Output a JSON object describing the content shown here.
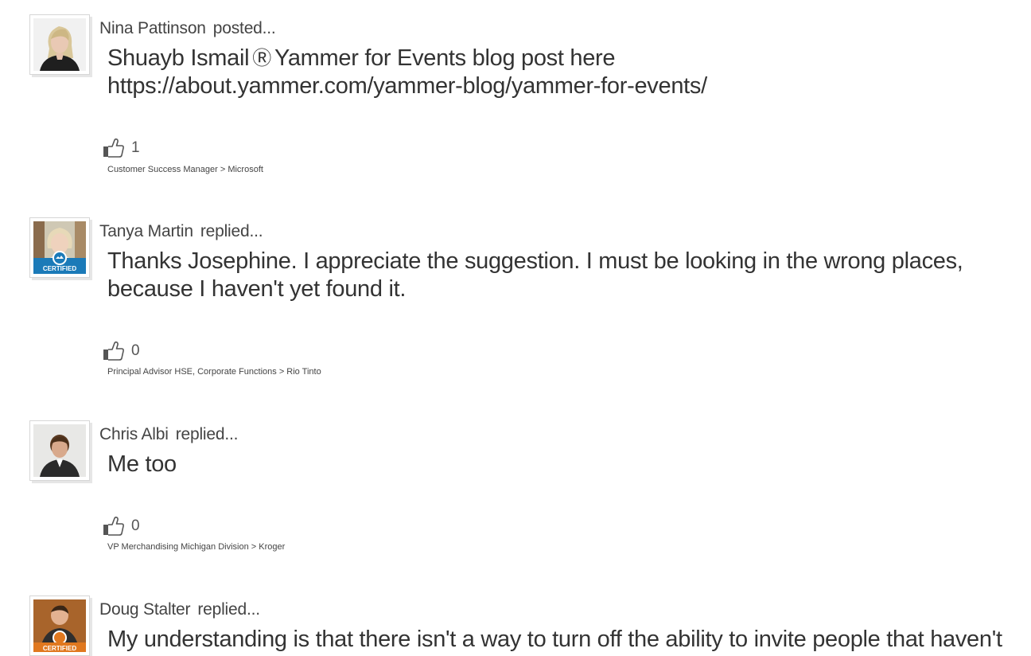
{
  "posts": [
    {
      "author": "Nina Pattinson",
      "action": "posted...",
      "mention": "Shuayb Ismail",
      "mention_icon": "yammer-icon",
      "body": "Yammer for Events blog post here https://about.yammer.com/yammer-blog/yammer-for-events/",
      "likes": "1",
      "byline": "Customer Success Manager > Microsoft"
    },
    {
      "author": "Tanya Martin",
      "action": "replied...",
      "body": "Thanks Josephine. I appreciate the suggestion. I must be looking in the wrong places, because I haven't yet found it.",
      "likes": "0",
      "byline": "Principal Advisor HSE, Corporate Functions > Rio Tinto",
      "badge": "CERTIFIED"
    },
    {
      "author": "Chris Albi",
      "action": "replied...",
      "body": "Me too",
      "likes": "0",
      "byline": "VP Merchandising Michigan Division > Kroger"
    },
    {
      "author": "Doug Stalter",
      "action": "replied...",
      "body": "My understanding is that there isn't a way to turn off the ability to invite people that haven't",
      "badge": "CERTIFIED"
    }
  ],
  "colors": {
    "text": "#333333",
    "badge_blue": "#1b7ab8",
    "badge_orange": "#e0781f"
  }
}
